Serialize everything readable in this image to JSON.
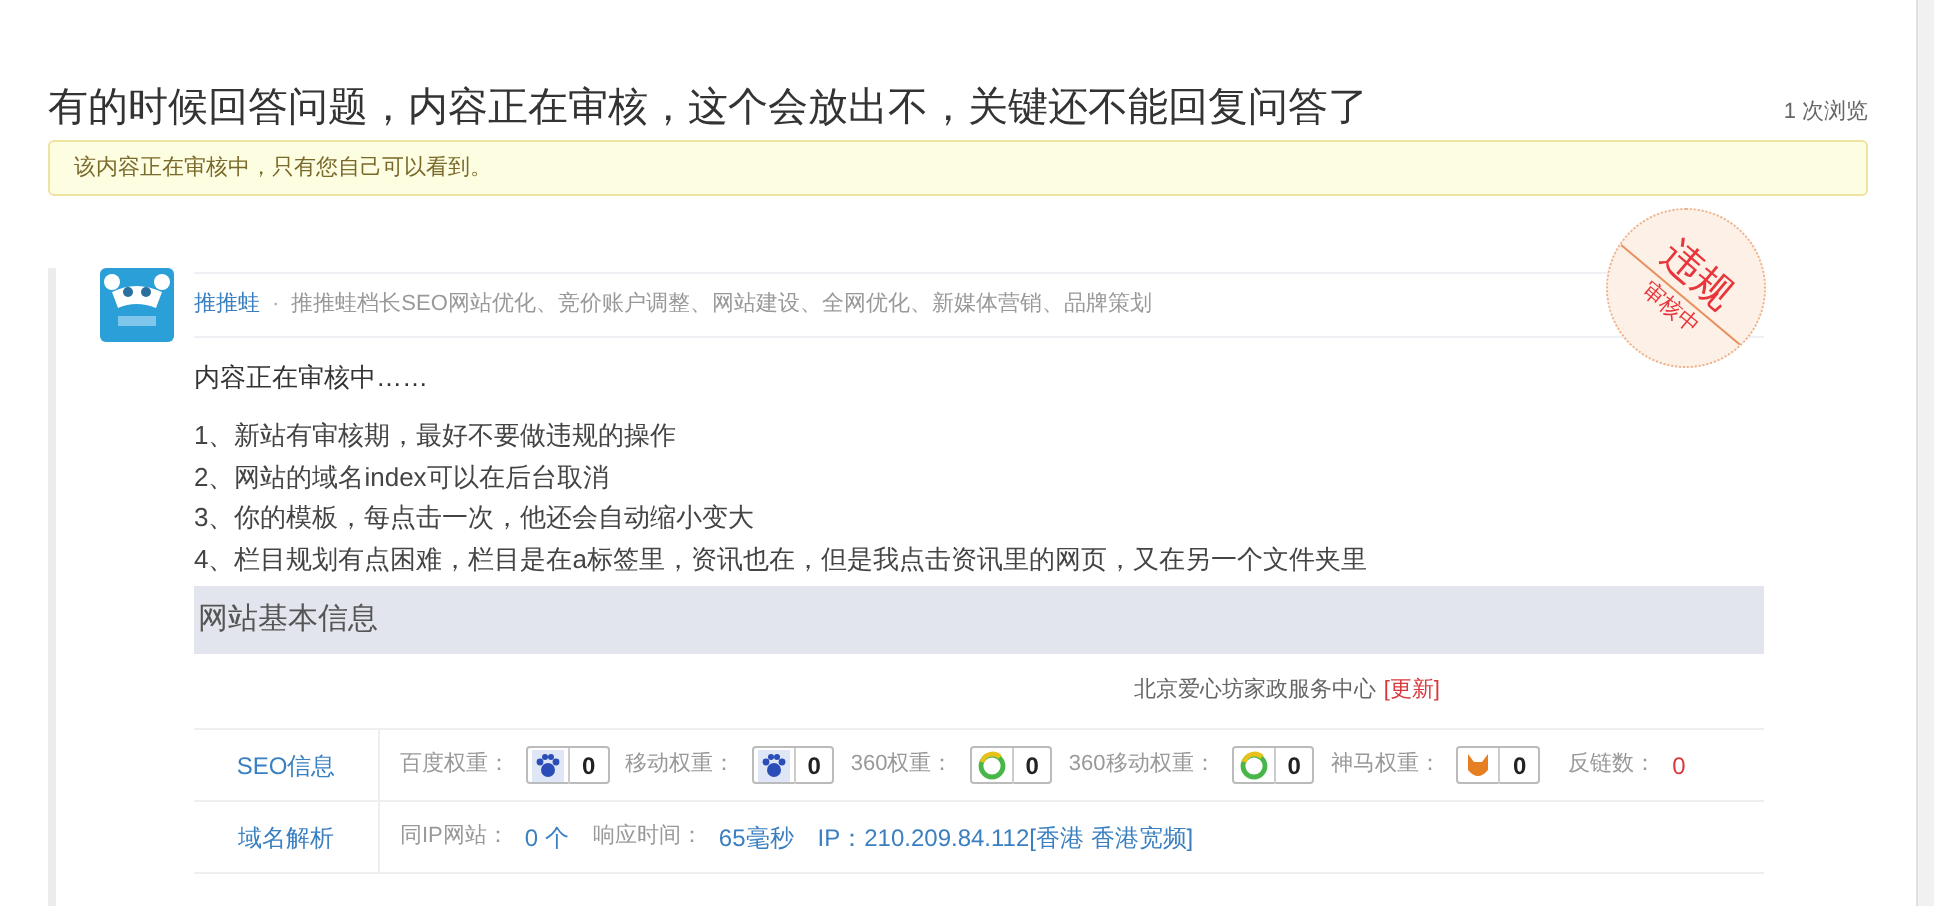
{
  "question": {
    "title": "有的时候回答问题，内容正在审核，这个会放出不，关键还不能回复问答了",
    "views": "1 次浏览"
  },
  "notice": "该内容正在审核中，只有您自己可以看到。",
  "answer": {
    "author": "推推蛙",
    "separator": "·",
    "bio": "推推蛙档长SEO网站优化、竞价账户调整、网站建设、全网优化、新媒体营销、品牌策划",
    "stamp": {
      "main": "违规",
      "sub": "审核中"
    },
    "status_text": "内容正在审核中……",
    "items": [
      "1、新站有审核期，最好不要做违规的操作",
      "2、网站的域名index可以在后台取消",
      "3、你的模板，每点击一次，他还会自动缩小变大",
      "4、栏目规划有点困难，栏目是在a标签里，资讯也在，但是我点击资讯里的网页，又在另一个文件夹里"
    ],
    "site_info": {
      "heading": "网站基本信息",
      "company": "北京爱心坊家政服务中心",
      "update_link": "[更新]",
      "rows": [
        {
          "kind": "seo",
          "label": "SEO信息",
          "metrics": [
            {
              "kind": "paw",
              "label": "百度权重：",
              "value": "0"
            },
            {
              "kind": "paw",
              "label": "移动权重：",
              "value": "0"
            },
            {
              "kind": "ring",
              "label": "360权重：",
              "value": "0"
            },
            {
              "kind": "ring",
              "label": "360移动权重：",
              "value": "0"
            },
            {
              "kind": "fox",
              "label": "神马权重：",
              "value": "0"
            }
          ],
          "backlinks": {
            "label": "反链数：",
            "value": "0"
          }
        },
        {
          "kind": "domain",
          "label": "域名解析",
          "parts": [
            {
              "kind": "label",
              "text": "同IP网站："
            },
            {
              "kind": "value",
              "text": "0 个"
            },
            {
              "kind": "label",
              "text": "响应时间："
            },
            {
              "kind": "value",
              "text": "65毫秒"
            },
            {
              "kind": "value",
              "text": "IP：210.209.84.112[香港 香港宽频]"
            }
          ]
        }
      ]
    }
  }
}
